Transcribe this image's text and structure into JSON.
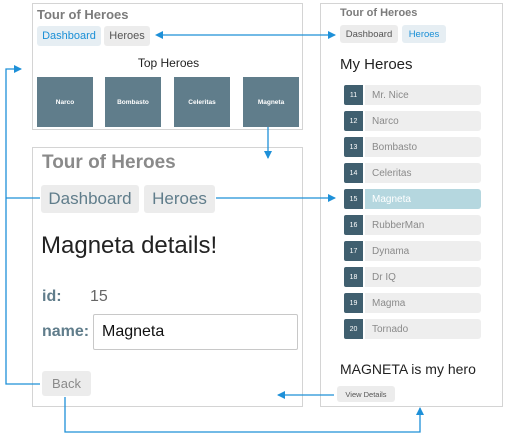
{
  "app_title": "Tour of Heroes",
  "nav": {
    "dashboard": "Dashboard",
    "heroes": "Heroes"
  },
  "dashboard": {
    "heading": "Top Heroes",
    "tiles": [
      "Narco",
      "Bombasto",
      "Celeritas",
      "Magneta"
    ]
  },
  "detail": {
    "heading": "Magneta details!",
    "id_label": "id:",
    "id_value": "15",
    "name_label": "name:",
    "name_value": "Magneta",
    "back_label": "Back"
  },
  "heroes_list": {
    "heading": "My Heroes",
    "selected_id": "15",
    "items": [
      {
        "id": "11",
        "name": "Mr. Nice"
      },
      {
        "id": "12",
        "name": "Narco"
      },
      {
        "id": "13",
        "name": "Bombasto"
      },
      {
        "id": "14",
        "name": "Celeritas"
      },
      {
        "id": "15",
        "name": "Magneta"
      },
      {
        "id": "16",
        "name": "RubberMan"
      },
      {
        "id": "17",
        "name": "Dynama"
      },
      {
        "id": "18",
        "name": "Dr IQ"
      },
      {
        "id": "19",
        "name": "Magma"
      },
      {
        "id": "20",
        "name": "Tornado"
      }
    ],
    "selected_message": "MAGNETA is my hero",
    "view_details_label": "View Details"
  },
  "colors": {
    "tile": "#607d8b",
    "badge": "#405f6f",
    "link_blue": "#1a8fd6",
    "arrow": "#1e90d8",
    "selected_row": "#b5d7df",
    "muted_text": "#7b7b7b",
    "label_text": "#607d8b"
  }
}
